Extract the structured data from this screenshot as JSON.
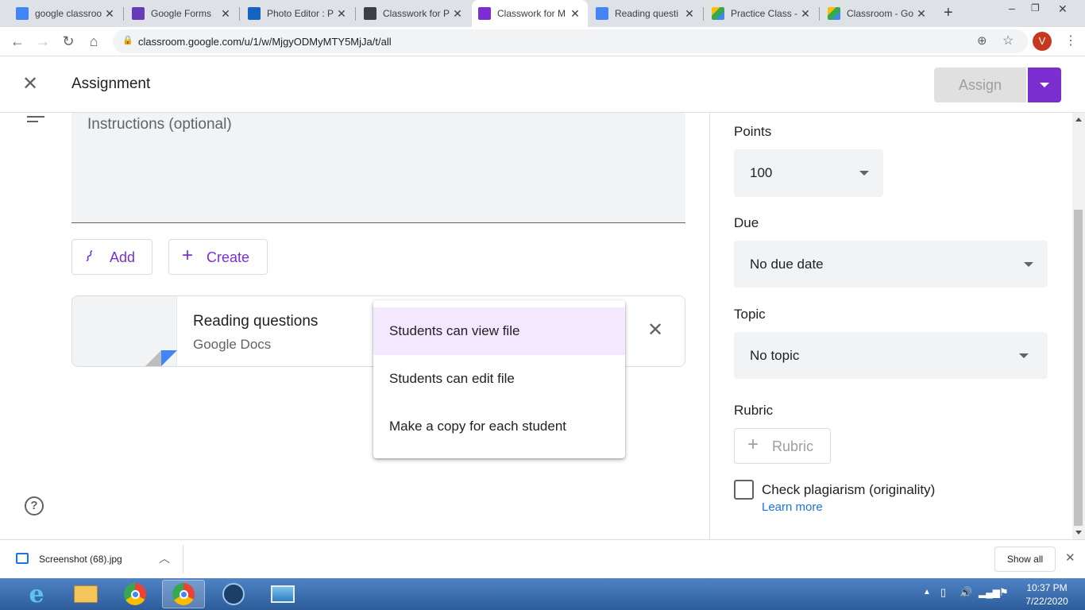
{
  "tabs": [
    {
      "title": "google classroo",
      "fav_color": "#4285f4",
      "fav_icon": "docs-icon"
    },
    {
      "title": "Google Forms",
      "fav_color": "#673ab7",
      "fav_icon": "forms-icon"
    },
    {
      "title": "Photo Editor : P",
      "fav_color": "#1565c0",
      "fav_icon": "photo-editor-icon"
    },
    {
      "title": "Classwork for P",
      "fav_color": "#3c4043",
      "fav_icon": "classroom-icon"
    },
    {
      "title": "Classwork for M",
      "fav_color": "#7b2fd1",
      "fav_icon": "classroom-icon"
    },
    {
      "title": "Reading questi",
      "fav_color": "#4285f4",
      "fav_icon": "docs-icon"
    },
    {
      "title": "Practice Class -",
      "fav_color": "#34a853",
      "fav_icon": "drive-icon"
    },
    {
      "title": "Classroom - Go",
      "fav_color": "#34a853",
      "fav_icon": "drive-icon"
    }
  ],
  "address": {
    "url": "classroom.google.com/u/1/w/MjgyODMyMTY5MjJa/t/all",
    "avatar_letter": "V"
  },
  "header": {
    "title": "Assignment",
    "assign_label": "Assign"
  },
  "instructions": {
    "placeholder": "Instructions (optional)"
  },
  "buttons": {
    "add": "Add",
    "create": "Create"
  },
  "attachment": {
    "title": "Reading questions",
    "subtitle": "Google Docs"
  },
  "share_menu": {
    "items": [
      "Students can view file",
      "Students can edit file",
      "Make a copy for each student"
    ],
    "selected_index": 0
  },
  "right_panel": {
    "points_label": "Points",
    "points_value": "100",
    "due_label": "Due",
    "due_value": "No due date",
    "topic_label": "Topic",
    "topic_value": "No topic",
    "rubric_label": "Rubric",
    "rubric_button": "Rubric",
    "plagiarism_label": "Check plagiarism (originality)",
    "learn_more": "Learn more"
  },
  "download": {
    "filename": "Screenshot (68).jpg",
    "show_all": "Show all"
  },
  "clock": {
    "time": "10:37 PM",
    "date": "7/22/2020"
  },
  "colors": {
    "accent": "#7b2fd1",
    "menu_selected": "#f3e8fd",
    "link": "#1a73e8"
  }
}
